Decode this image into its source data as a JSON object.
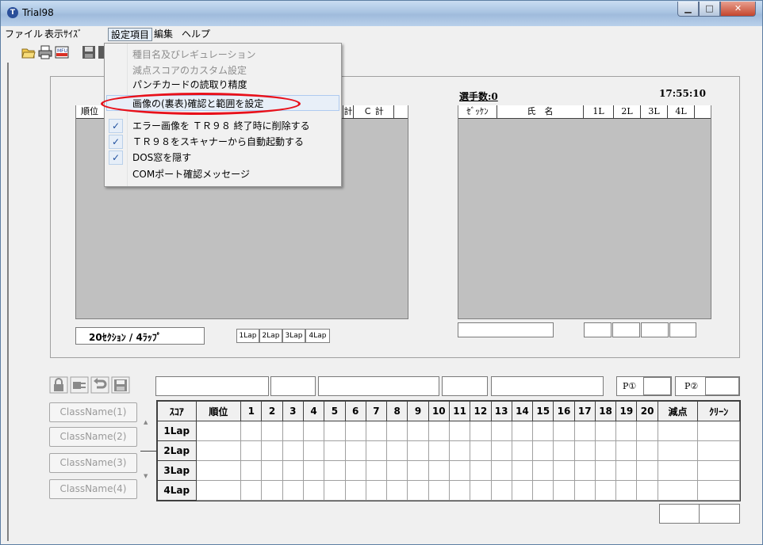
{
  "window": {
    "title": "Trial98"
  },
  "menubar": {
    "items": [
      "ファイル",
      "表示ｻｲｽﾞ",
      "設定項目",
      "編集",
      "ヘルプ"
    ],
    "active_index": 2
  },
  "dropdown": {
    "items": [
      {
        "label": "種目名及びレギュレーション",
        "checked": false,
        "disabled": true
      },
      {
        "label": "減点スコアのカスタム設定",
        "checked": false,
        "disabled": true
      },
      {
        "label": "パンチカードの読取り精度",
        "checked": false,
        "disabled": false
      },
      {
        "label": "画像の(裏表)確認と範囲を設定",
        "checked": false,
        "disabled": false,
        "highlighted": true
      },
      {
        "label": "エラー画像を ＴＲ９８ 終了時に削除する",
        "checked": true,
        "disabled": false
      },
      {
        "label": "ＴＲ９８をスキャナーから自動起動する",
        "checked": true,
        "disabled": false
      },
      {
        "label": "DOS窓を隠す",
        "checked": true,
        "disabled": false
      },
      {
        "label": "COMポート確認メッセージ",
        "checked": false,
        "disabled": false
      }
    ]
  },
  "left_panel": {
    "header_visible": [
      "順位",
      "計",
      "Ｃ 計"
    ],
    "sections_label": "20ｾｸｼｮﾝ / 4ﾗｯﾌﾟ",
    "lap_buttons": [
      "1Lap",
      "2Lap",
      "3Lap",
      "4Lap"
    ]
  },
  "right_panel": {
    "players_label": "選手数:0",
    "time": "17:55:10",
    "headers": [
      "ｾﾞｯｹﾝ",
      "氏　名",
      "1L",
      "2L",
      "3L",
      "4L"
    ]
  },
  "lower": {
    "p1_label": "P①",
    "p2_label": "P②",
    "class_buttons": [
      "ClassName(1)",
      "ClassName(2)",
      "ClassName(3)",
      "ClassName(4)"
    ],
    "grid_headers": [
      "ｽｺｱ",
      "順位",
      "1",
      "2",
      "3",
      "4",
      "5",
      "6",
      "7",
      "8",
      "9",
      "10",
      "11",
      "12",
      "13",
      "14",
      "15",
      "16",
      "17",
      "18",
      "19",
      "20",
      "減点",
      "ｸﾘｰﾝ"
    ],
    "grid_rows": [
      "1Lap",
      "2Lap",
      "3Lap",
      "4Lap"
    ]
  },
  "colors": {
    "highlight_ellipse": "#e8101a",
    "panel_gray": "#c0c0c0",
    "check": "#1f4f9e"
  }
}
